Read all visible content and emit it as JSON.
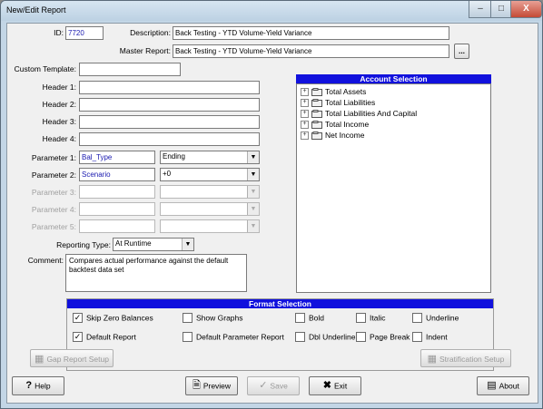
{
  "window": {
    "title": "New/Edit Report",
    "controls": {
      "minimize": "–",
      "maximize": "□",
      "close": "X"
    }
  },
  "form": {
    "id_label": "ID:",
    "id_value": "7720",
    "description_label": "Description:",
    "description_value": "Back Testing -  YTD Volume-Yield Variance",
    "master_report_label": "Master Report:",
    "master_report_value": "Back Testing -  YTD Volume-Yield Variance",
    "browse_label": "...",
    "custom_template_label": "Custom Template:",
    "custom_template_value": "",
    "headers": [
      {
        "label": "Header 1:",
        "value": ""
      },
      {
        "label": "Header 2:",
        "value": ""
      },
      {
        "label": "Header 3:",
        "value": ""
      },
      {
        "label": "Header 4:",
        "value": ""
      }
    ],
    "parameters": [
      {
        "label": "Parameter 1:",
        "value": "Bal_Type",
        "option": "Ending",
        "enabled": true
      },
      {
        "label": "Parameter 2:",
        "value": "Scenario",
        "option": "+0",
        "enabled": true
      },
      {
        "label": "Parameter 3:",
        "value": "",
        "option": "",
        "enabled": false
      },
      {
        "label": "Parameter 4:",
        "value": "",
        "option": "",
        "enabled": false
      },
      {
        "label": "Parameter 5:",
        "value": "",
        "option": "",
        "enabled": false
      }
    ],
    "reporting_type_label": "Reporting Type:",
    "reporting_type_value": "At Runtime",
    "comment_label": "Comment:",
    "comment_value": "Compares actual performance against the default backtest data set"
  },
  "account_selection": {
    "title": "Account Selection",
    "items": [
      "Total Assets",
      "Total Liabilities",
      "Total Liabilities And Capital",
      "Total Income",
      "Net Income"
    ]
  },
  "format_selection": {
    "title": "Format Selection",
    "options": [
      {
        "label": "Skip Zero Balances",
        "checked": true
      },
      {
        "label": "Show Graphs",
        "checked": false
      },
      {
        "label": "Bold",
        "checked": false
      },
      {
        "label": "Italic",
        "checked": false
      },
      {
        "label": "Underline",
        "checked": false
      },
      {
        "label": "Default Report",
        "checked": true
      },
      {
        "label": "Default Parameter Report",
        "checked": false
      },
      {
        "label": "Dbl Underline",
        "checked": false
      },
      {
        "label": "Page Break",
        "checked": false
      },
      {
        "label": "Indent",
        "checked": false
      }
    ]
  },
  "buttons": {
    "gap_report": "Gap Report Setup",
    "stratification": "Stratification Setup",
    "help": "Help",
    "preview": "Preview",
    "save": "Save",
    "exit": "Exit",
    "about": "About"
  }
}
